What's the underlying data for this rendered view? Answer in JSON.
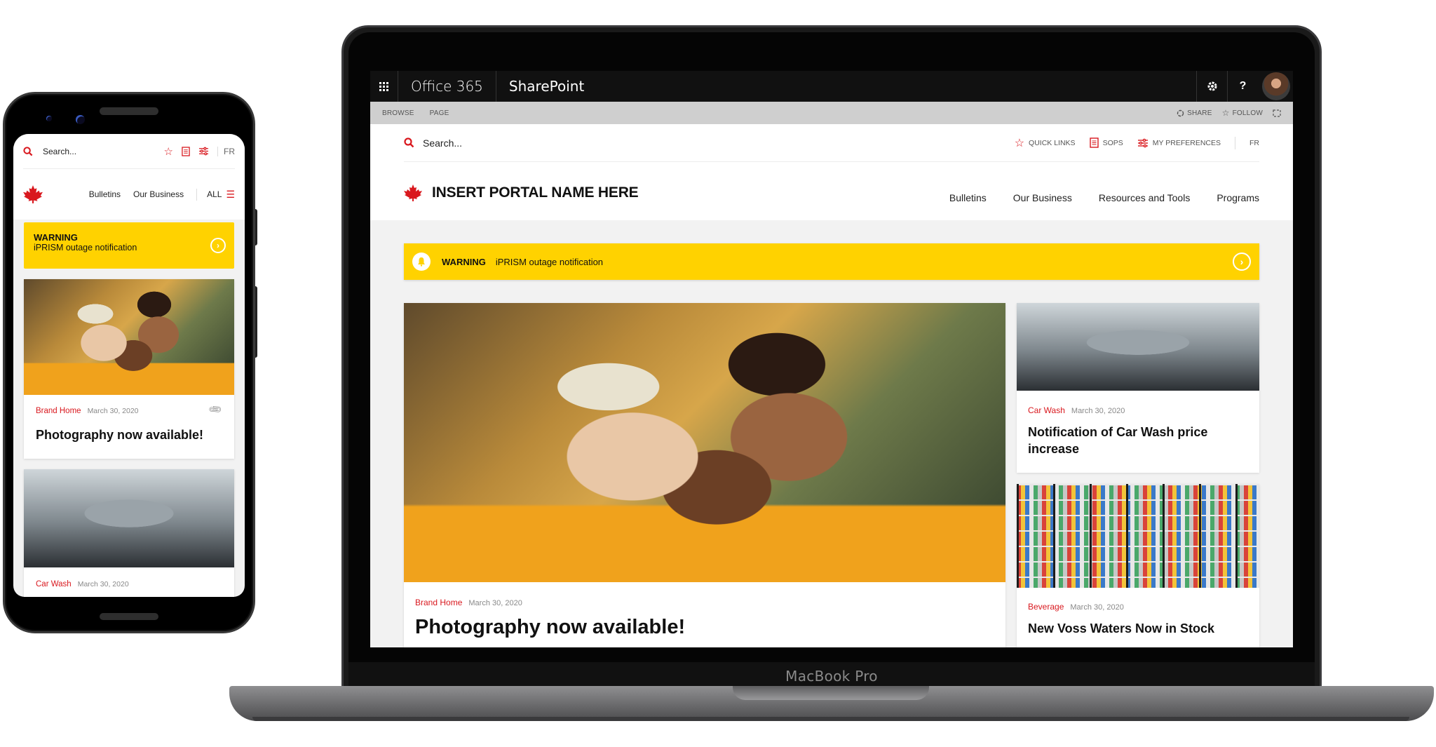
{
  "laptop": {
    "device_label": "MacBook Pro",
    "o365_bar": {
      "waffle_icon": "app-launcher-icon",
      "brand": "Office 365",
      "app": "SharePoint",
      "settings_icon": "gear-icon",
      "help_label": "?"
    },
    "ribbon": {
      "tabs": [
        "BROWSE",
        "PAGE"
      ],
      "share_label": "SHARE",
      "follow_label": "FOLLOW"
    },
    "utility": {
      "search_placeholder": "Search...",
      "quick_links": "QUICK LINKS",
      "sops": "SOPS",
      "preferences": "MY PREFERENCES",
      "language": "FR"
    },
    "portal_name": "INSERT PORTAL NAME HERE",
    "nav": [
      "Bulletins",
      "Our Business",
      "Resources and Tools",
      "Programs"
    ],
    "warning": {
      "label": "WARNING",
      "message": "iPRISM outage notification"
    },
    "cards": [
      {
        "category": "Brand Home",
        "date": "March 30, 2020",
        "title": "Photography now available!"
      },
      {
        "category": "Car Wash",
        "date": "March 30, 2020",
        "title": "Notification of Car Wash price increase"
      },
      {
        "category": "Beverage",
        "date": "March 30, 2020",
        "title": "New Voss Waters Now in Stock"
      }
    ]
  },
  "phone": {
    "search_placeholder": "Search...",
    "language": "FR",
    "nav": [
      "Bulletins",
      "Our Business"
    ],
    "all_label": "ALL",
    "warning": {
      "label": "WARNING",
      "message": "iPRISM outage notification"
    },
    "cards": [
      {
        "category": "Brand Home",
        "date": "March 30, 2020",
        "title": "Photography now available!"
      },
      {
        "category": "Car Wash",
        "date": "March 30, 2020"
      }
    ]
  },
  "colors": {
    "accent_red": "#d9181e",
    "warning_yellow": "#ffd200",
    "o365_bar": "#111111",
    "ribbon": "#cfcfcf"
  }
}
